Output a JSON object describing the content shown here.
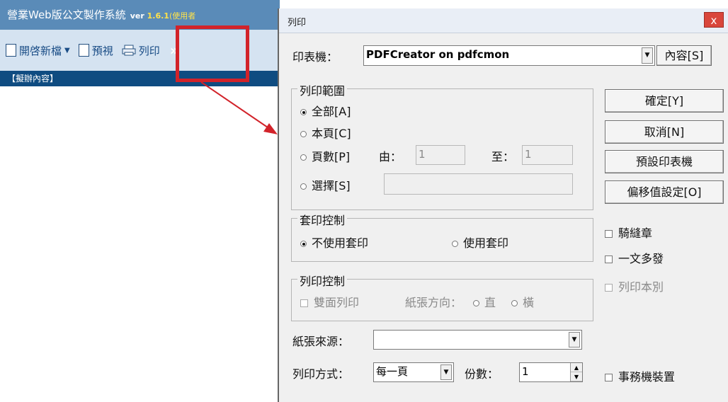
{
  "app": {
    "title": "營業Web版公文製作系統",
    "version_prefix": "ver ",
    "version_number": "1.6.1",
    "user_label": "(使用者",
    "toolbar": {
      "new_label": "開啓新檔",
      "preview_label": "預視",
      "print_label": "列印",
      "more_label": "»"
    },
    "section_label": "【擬辦內容】"
  },
  "dialog": {
    "title": "列印",
    "close_label": "x",
    "printer_label": "印表機：",
    "printer_value": "PDFCreator on pdfcmon",
    "properties_button": "內容[S]",
    "print_range": {
      "legend": "列印範圍",
      "all": "全部[A]",
      "current_page": "本頁[C]",
      "pages": "頁數[P]",
      "from_label": "由：",
      "from_value": "1",
      "to_label": "至：",
      "to_value": "1",
      "selection": "選擇[S]",
      "selected": "all"
    },
    "buttons": {
      "ok": "確定[Y]",
      "cancel": "取消[N]",
      "default_printer": "預設印表機",
      "offset": "偏移值設定[O]"
    },
    "overprint": {
      "legend": "套印控制",
      "no_overprint": "不使用套印",
      "use_overprint": "使用套印",
      "selected": "no_overprint"
    },
    "print_control": {
      "legend": "列印控制",
      "duplex": "雙面列印",
      "orientation_label": "紙張方向：",
      "portrait": "直",
      "landscape": "橫"
    },
    "checkboxes": {
      "seal": "騎縫章",
      "multi_send": "一文多發",
      "print_copy": "列印本別",
      "mfp": "事務機裝置"
    },
    "paper_source_label": "紙張來源：",
    "paper_source_value": "",
    "print_mode_label": "列印方式：",
    "print_mode_value": "每一頁",
    "copies_label": "份數：",
    "copies_value": "1"
  },
  "colors": {
    "highlight": "#d2232a",
    "title_bar": "#5a8bb8",
    "section_bar": "#0f4c81"
  }
}
